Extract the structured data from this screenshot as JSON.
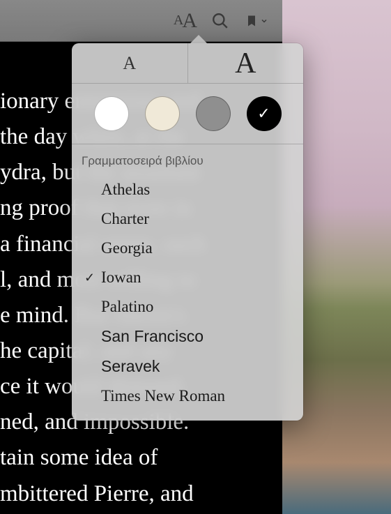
{
  "reader_text": "ionary enterprise; and\nthe day when, at the\nydra, but the assailant\nng proof that even in\na financial sense, such\nl, and most willing to\ne mind. But Alexis's\nhe capital; and any\nce it would demand,\nned, and impossible.\ntain some idea of\nmbittered Pierre, and\ne unsatisfactory state\nthat Count Reist",
  "toolbar": {
    "appearance_small": "A",
    "appearance_big": "A"
  },
  "popover": {
    "decrease_label": "A",
    "increase_label": "A",
    "themes": [
      {
        "id": "white",
        "color": "#ffffff",
        "selected": false
      },
      {
        "id": "sepia",
        "color": "#f0e9d8",
        "selected": false
      },
      {
        "id": "gray",
        "color": "#8f8f8f",
        "selected": false
      },
      {
        "id": "night",
        "color": "#000000",
        "selected": true
      }
    ],
    "font_header": "Γραμματοσειρά βιβλίου",
    "fonts": [
      {
        "name": "Athelas",
        "family": "Athelas, Georgia, serif",
        "selected": false
      },
      {
        "name": "Charter",
        "family": "Charter, Georgia, serif",
        "selected": false
      },
      {
        "name": "Georgia",
        "family": "Georgia, serif",
        "selected": false
      },
      {
        "name": "Iowan",
        "family": "'Iowan Old Style', Georgia, serif",
        "selected": true
      },
      {
        "name": "Palatino",
        "family": "Palatino, Georgia, serif",
        "selected": false
      },
      {
        "name": "San Francisco",
        "family": "-apple-system, 'Helvetica Neue', Arial, sans-serif",
        "selected": false
      },
      {
        "name": "Seravek",
        "family": "Seravek, Arial, sans-serif",
        "selected": false
      },
      {
        "name": "Times New Roman",
        "family": "'Times New Roman', serif",
        "selected": false
      }
    ],
    "checkmark": "✓"
  }
}
